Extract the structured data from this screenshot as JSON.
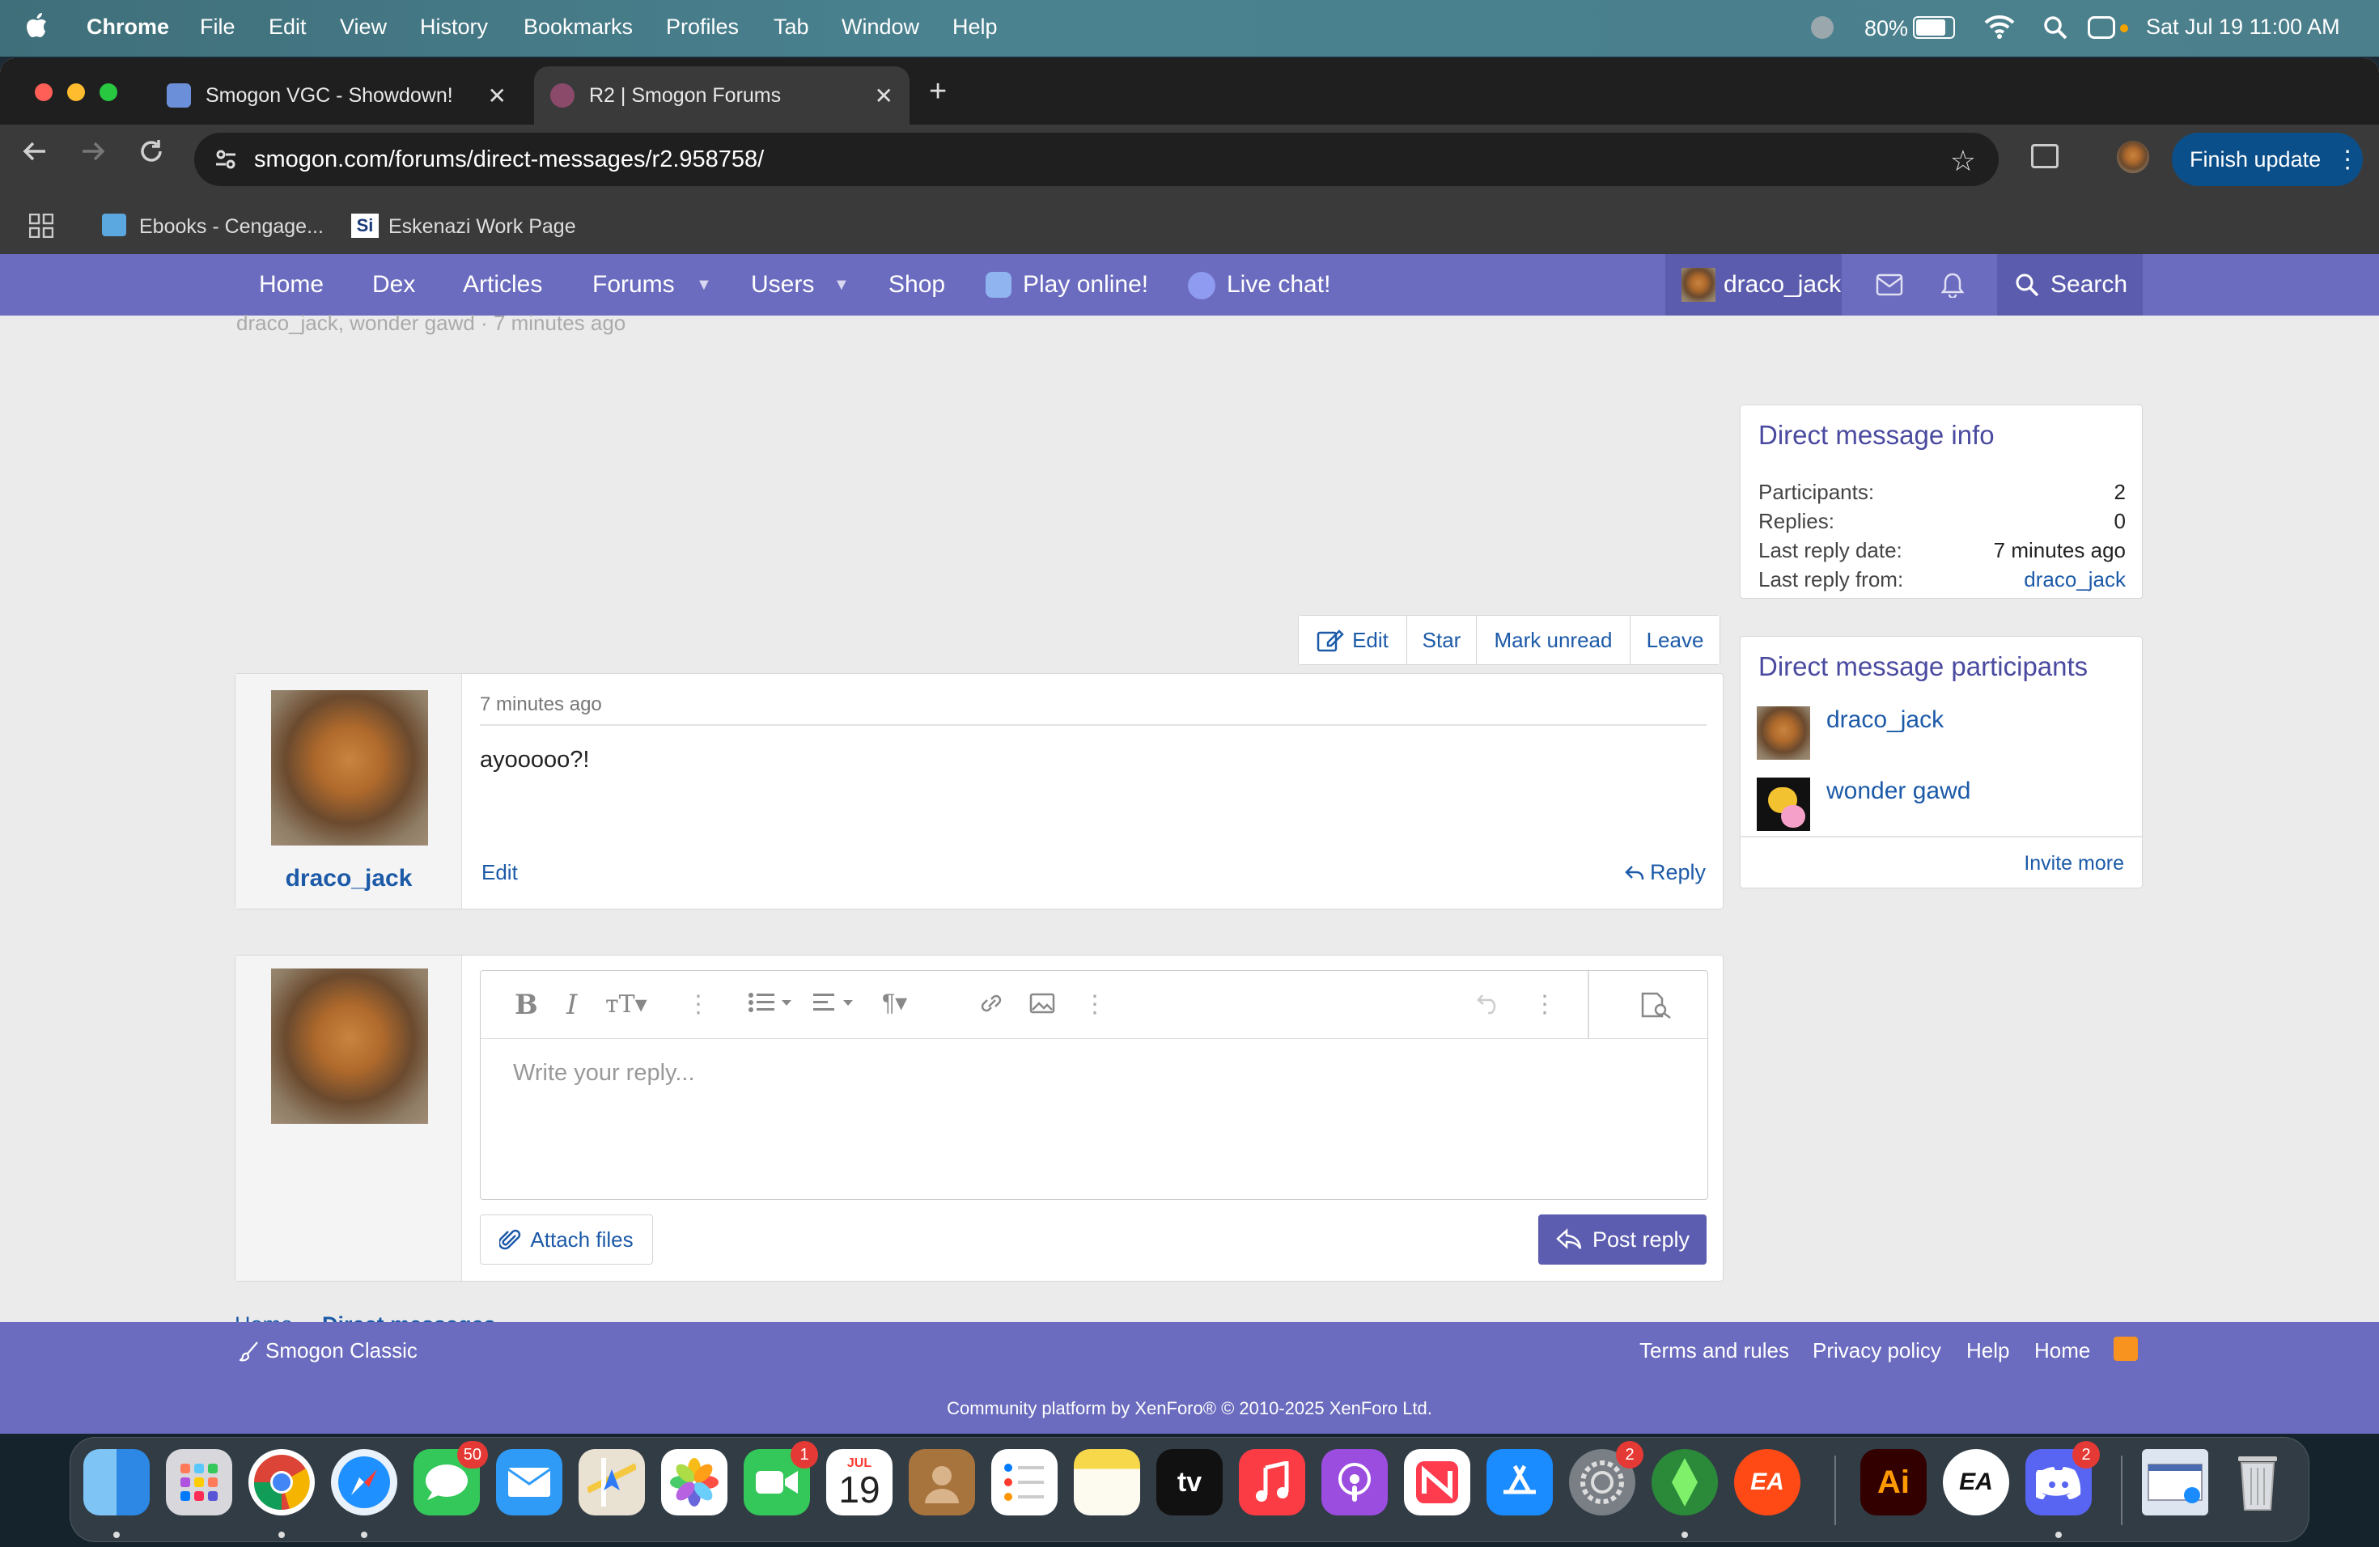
{
  "menubar": {
    "app": "Chrome",
    "items": [
      "File",
      "Edit",
      "View",
      "History",
      "Bookmarks",
      "Profiles",
      "Tab",
      "Window",
      "Help"
    ],
    "battery": "80%",
    "datetime": "Sat Jul 19  11:00 AM"
  },
  "browser": {
    "tabs": [
      {
        "title": "Smogon VGC - Showdown!",
        "active": false
      },
      {
        "title": "R2 | Smogon Forums",
        "active": true
      }
    ],
    "new_tab": "+",
    "url": "smogon.com/forums/direct-messages/r2.958758/",
    "finish_update": "Finish update",
    "bookmarks": [
      "Ebooks - Cengage...",
      "Eskenazi Work Page"
    ]
  },
  "site_nav": {
    "items": [
      "Home",
      "Dex",
      "Articles",
      "Forums",
      "Users",
      "Shop",
      "Play online!",
      "Live chat!"
    ],
    "username": "draco_jack",
    "search": "Search"
  },
  "header_partial": "draco_jack, wonder gawd · 7 minutes ago",
  "actions": [
    "Edit",
    "Star",
    "Mark unread",
    "Leave"
  ],
  "message": {
    "author": "draco_jack",
    "time": "7 minutes ago",
    "body": "ayooooo?!",
    "edit": "Edit",
    "reply": "Reply"
  },
  "reply_box": {
    "placeholder": "Write your reply...",
    "attach": "Attach files",
    "post": "Post reply"
  },
  "breadcrumb": [
    "Home",
    "Direct messages"
  ],
  "info": {
    "title": "Direct message info",
    "rows": [
      {
        "label": "Participants:",
        "value": "2"
      },
      {
        "label": "Replies:",
        "value": "0"
      },
      {
        "label": "Last reply date:",
        "value": "7 minutes ago"
      },
      {
        "label": "Last reply from:",
        "value": "draco_jack"
      }
    ]
  },
  "participants": {
    "title": "Direct message participants",
    "users": [
      "draco_jack",
      "wonder gawd"
    ],
    "invite": "Invite more"
  },
  "footer": {
    "classic": "Smogon Classic",
    "links": [
      "Terms and rules",
      "Privacy policy",
      "Help",
      "Home"
    ],
    "credit": "Community platform by XenForo® © 2010-2025 XenForo Ltd."
  },
  "dock": {
    "badges": {
      "messages": "50",
      "facetime": "1",
      "settings": "2",
      "discord": "2"
    },
    "calendar_month": "JUL",
    "calendar_day": "19",
    "tv": "tv",
    "ai": "Ai",
    "ea": "EA"
  },
  "colors": {
    "nav": "#6b6bbf",
    "link": "#1c5aa8",
    "accent": "#5c5cb0"
  }
}
